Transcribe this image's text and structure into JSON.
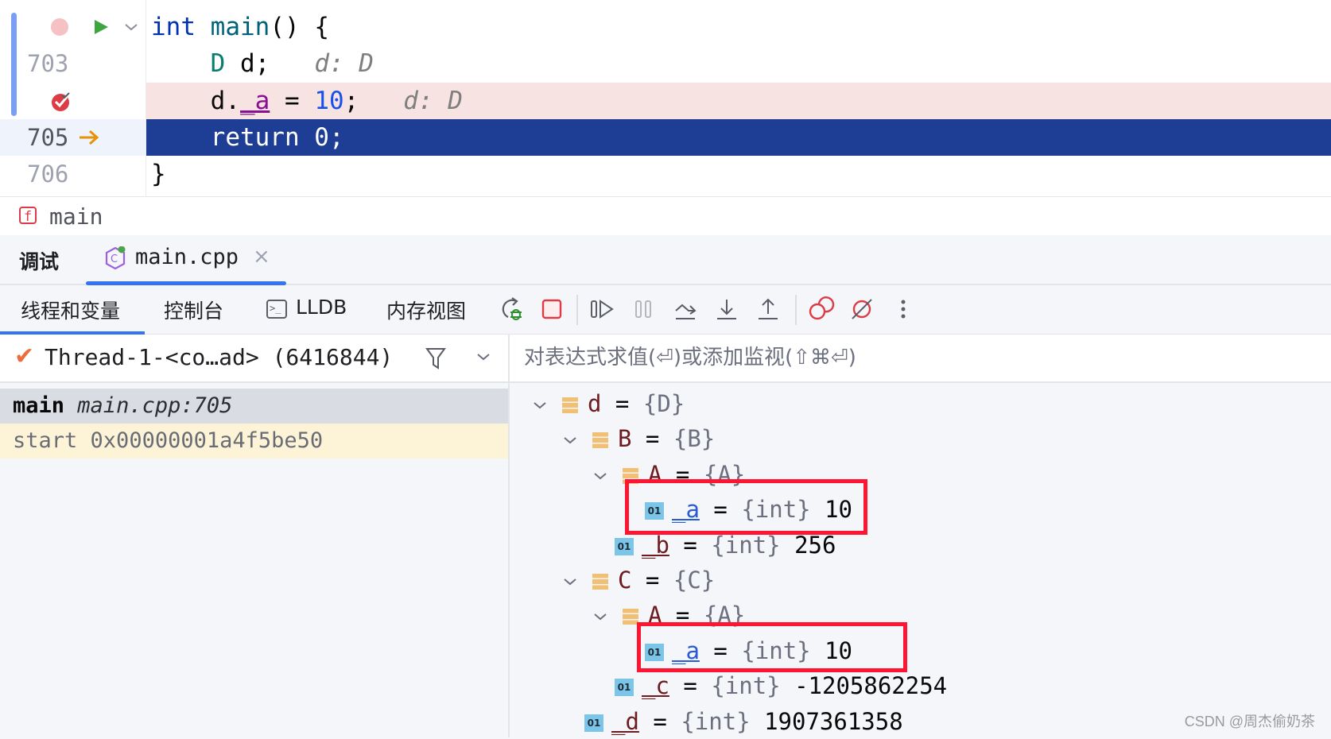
{
  "editor": {
    "lines": [
      {
        "number": "",
        "tokens": [
          {
            "t": "int",
            "c": "kw"
          },
          {
            "t": " "
          },
          {
            "t": "main",
            "c": "fn"
          },
          {
            "t": "() {"
          }
        ]
      },
      {
        "number": "703",
        "tokens": [
          {
            "t": "    "
          },
          {
            "t": "D",
            "c": "ty"
          },
          {
            "t": " d;"
          }
        ],
        "hint": "d: D"
      },
      {
        "number": "",
        "tokens": [
          {
            "t": "    d."
          },
          {
            "t": "_a",
            "c": "fld"
          },
          {
            "t": " = "
          },
          {
            "t": "10",
            "c": "num"
          },
          {
            "t": ";"
          }
        ],
        "hint": "d: D"
      },
      {
        "number": "705",
        "tokens": [
          {
            "t": "    return 0;"
          }
        ]
      },
      {
        "number": "706",
        "tokens": [
          {
            "t": "}"
          }
        ]
      }
    ]
  },
  "breadcrumb": {
    "function": "main"
  },
  "tabs": {
    "debug_label": "调试",
    "file_label": "main.cpp"
  },
  "toolbar": {
    "tabs": [
      "线程和变量",
      "控制台",
      "LLDB",
      "内存视图"
    ],
    "active_tab": "线程和变量"
  },
  "threads": {
    "selected_thread": "Thread-1-<co…ad> (6416844)",
    "frames": [
      {
        "func": "main",
        "location": "main.cpp:705"
      },
      {
        "func": "start",
        "location": "0x00000001a4f5be50"
      }
    ]
  },
  "variables": {
    "eval_placeholder": "对表达式求值(⏎)或添加监视(⇧⌘⏎)",
    "tree": [
      {
        "depth": 0,
        "expanded": true,
        "kind": "object",
        "name": "d",
        "type": "{D}",
        "value": ""
      },
      {
        "depth": 1,
        "expanded": true,
        "kind": "object",
        "name": "B",
        "type": "{B}",
        "value": ""
      },
      {
        "depth": 2,
        "expanded": true,
        "kind": "object",
        "name": "A",
        "type": "{A}",
        "value": ""
      },
      {
        "depth": 3,
        "kind": "int",
        "name": "_a",
        "type": "{int}",
        "value": "10",
        "highlighted": true
      },
      {
        "depth": 2,
        "kind": "int",
        "name": "_b",
        "type": "{int}",
        "value": "256"
      },
      {
        "depth": 1,
        "expanded": true,
        "kind": "object",
        "name": "C",
        "type": "{C}",
        "value": ""
      },
      {
        "depth": 2,
        "expanded": true,
        "kind": "object",
        "name": "A",
        "type": "{A}",
        "value": ""
      },
      {
        "depth": 3,
        "kind": "int",
        "name": "_a",
        "type": "{int}",
        "value": "10",
        "highlighted": true
      },
      {
        "depth": 2,
        "kind": "int",
        "name": "_c",
        "type": "{int}",
        "value": "-1205862254"
      },
      {
        "depth": 1,
        "kind": "int",
        "name": "_d",
        "type": "{int}",
        "value": "1907361358"
      }
    ]
  },
  "int_icon_text": "01",
  "watermark": "CSDN @周杰偷奶茶"
}
